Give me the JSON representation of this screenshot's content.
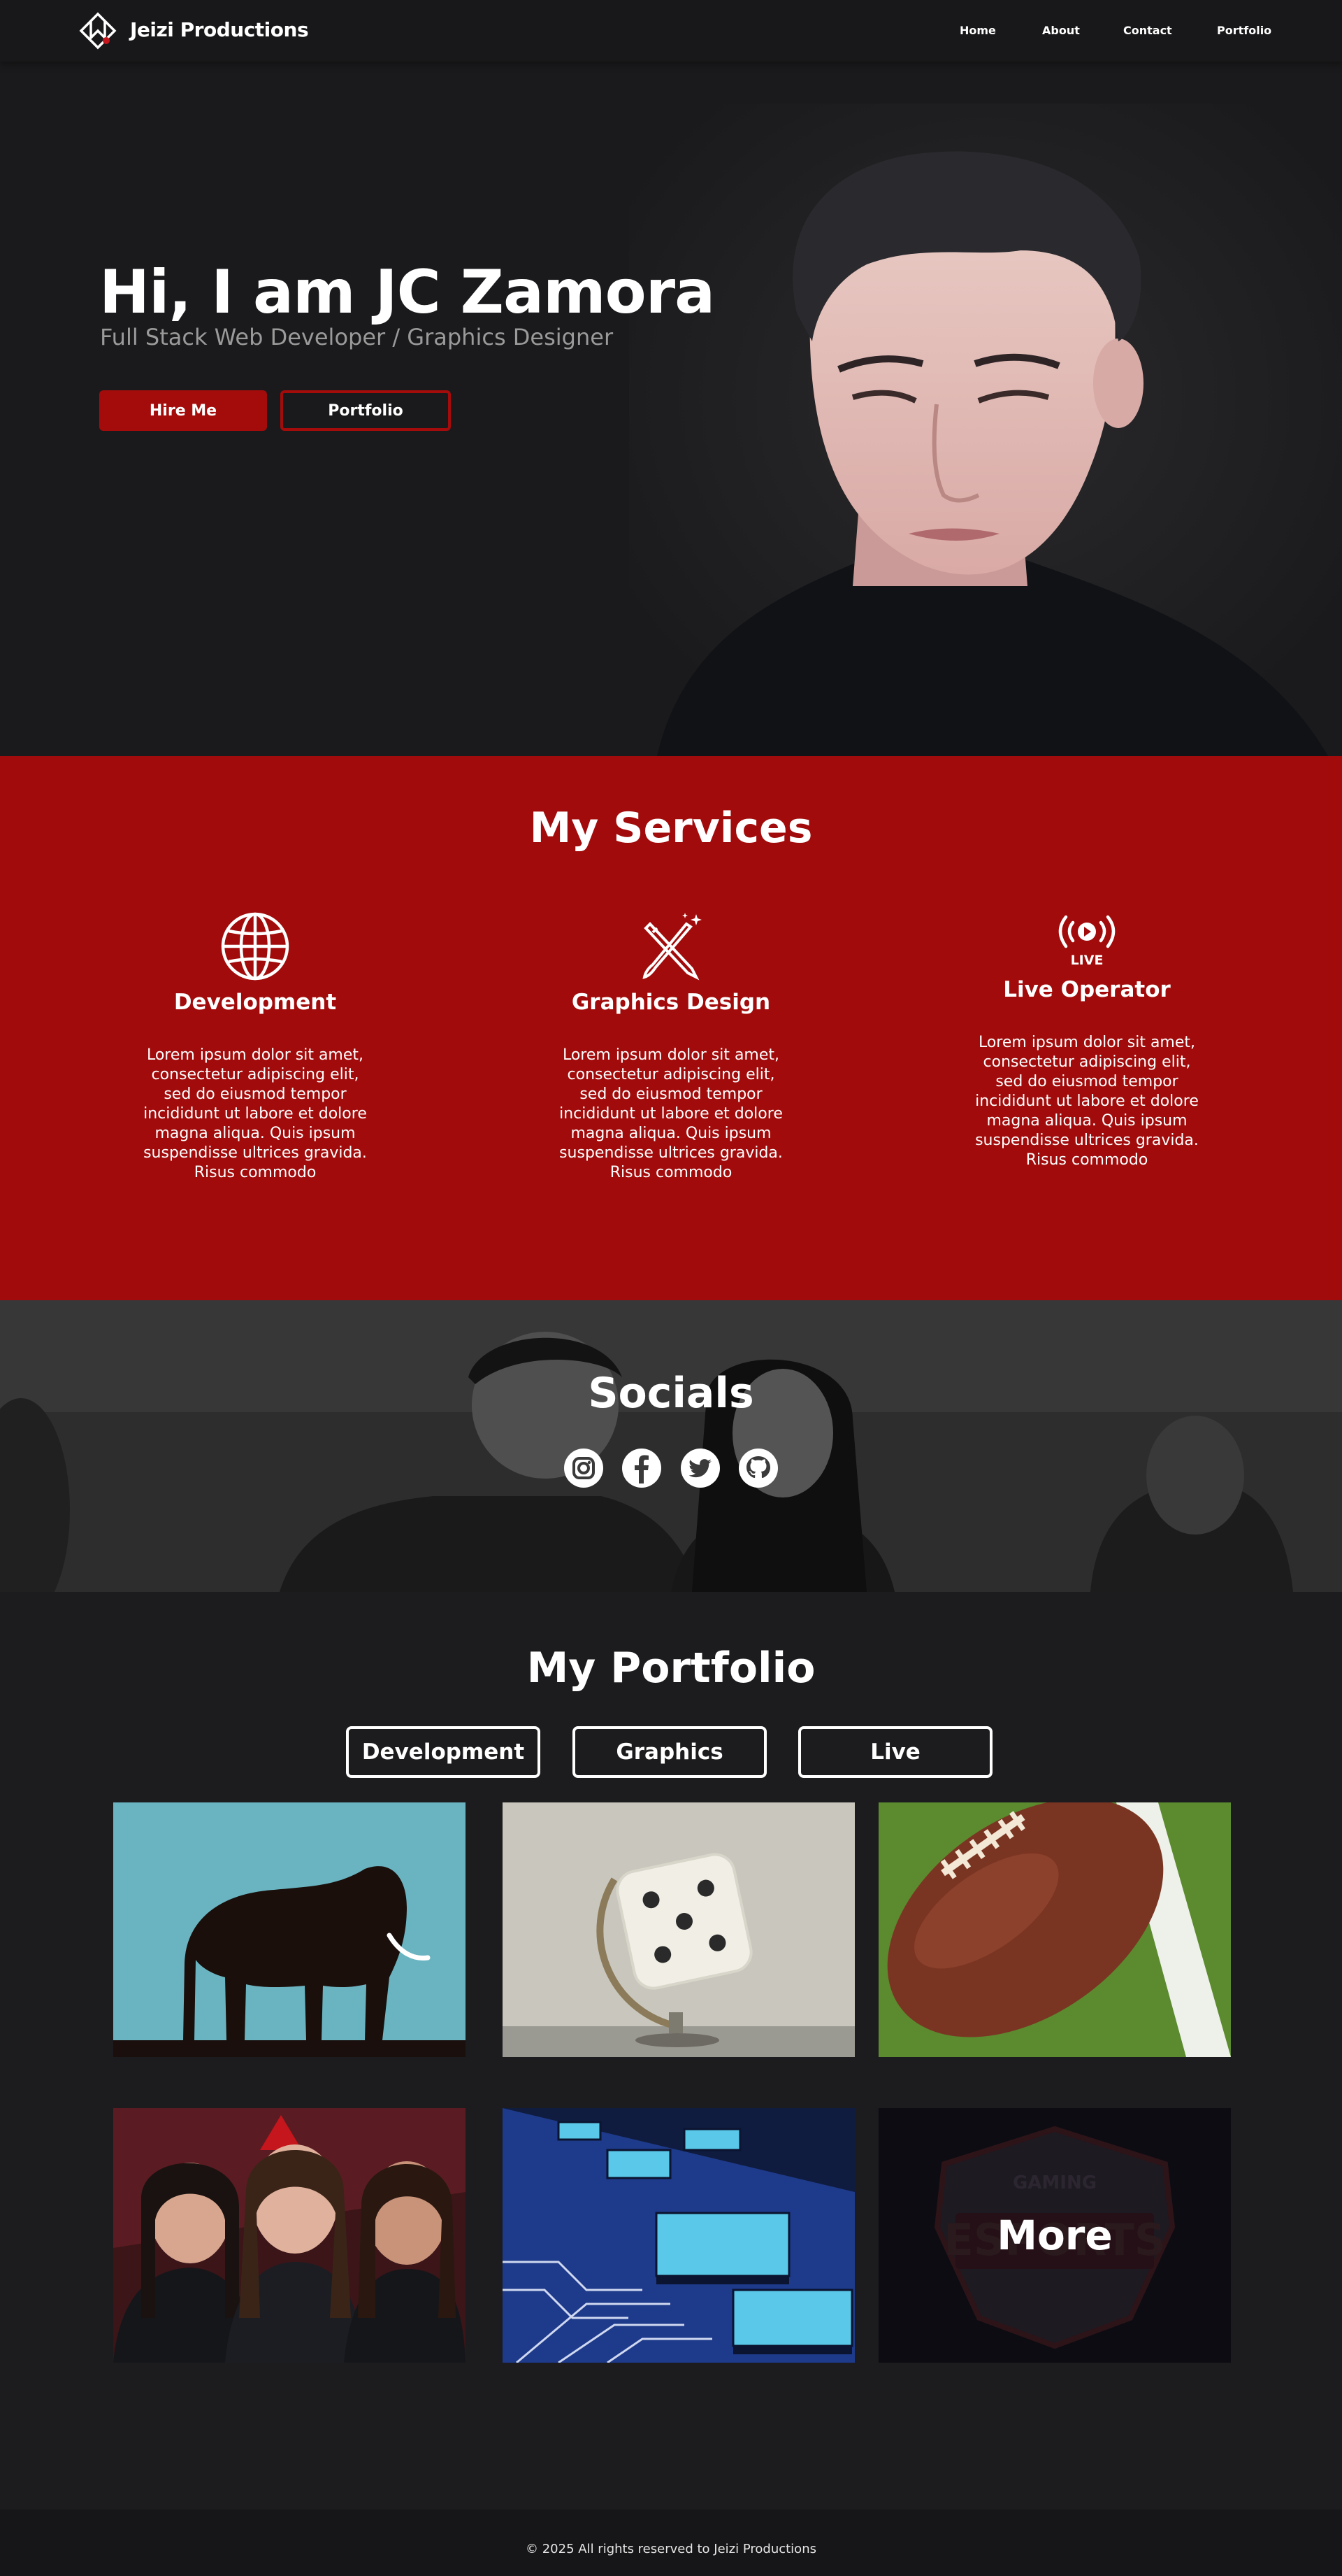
{
  "brand": {
    "name": "Jeizi Productions"
  },
  "nav": {
    "home": "Home",
    "about": "About",
    "contact": "Contact",
    "portfolio": "Portfolio"
  },
  "hero": {
    "title": "Hi, I am JC Zamora",
    "subtitle": "Full Stack Web Developer / Graphics Designer",
    "hire_label": "Hire Me",
    "portfolio_label": "Portfolio"
  },
  "services": {
    "title": "My Services",
    "items": [
      {
        "name": "Development",
        "icon": "globe-icon",
        "desc": "Lorem ipsum dolor sit amet, consectetur adipiscing elit, sed do eiusmod tempor incididunt ut labore et dolore magna aliqua. Quis ipsum suspendisse ultrices gravida. Risus commodo"
      },
      {
        "name": "Graphics Design",
        "icon": "pencil-brush-icon",
        "desc": "Lorem ipsum dolor sit amet, consectetur adipiscing elit, sed do eiusmod tempor incididunt ut labore et dolore magna aliqua. Quis ipsum suspendisse ultrices gravida. Risus commodo"
      },
      {
        "name": "Live Operator",
        "icon": "live-broadcast-icon",
        "icon_text": "LIVE",
        "desc": "Lorem ipsum dolor sit amet, consectetur adipiscing elit, sed do eiusmod tempor incididunt ut labore et dolore magna aliqua. Quis ipsum suspendisse ultrices gravida. Risus commodo"
      }
    ]
  },
  "socials": {
    "title": "Socials",
    "icons": [
      "instagram-icon",
      "facebook-icon",
      "twitter-icon",
      "github-icon"
    ]
  },
  "portfolio": {
    "title": "My Portfolio",
    "filters": [
      "Development",
      "Graphics",
      "Live"
    ],
    "more_label": "More",
    "more_badge_top": "GAMING",
    "more_badge_main": "ESPORTS"
  },
  "footer": {
    "copyright": "© 2025 All rights reserved to Jeizi Productions"
  },
  "colors": {
    "accent": "#a40c0c",
    "services_bg": "#a10b0b",
    "page_bg": "#1c1c1e"
  }
}
